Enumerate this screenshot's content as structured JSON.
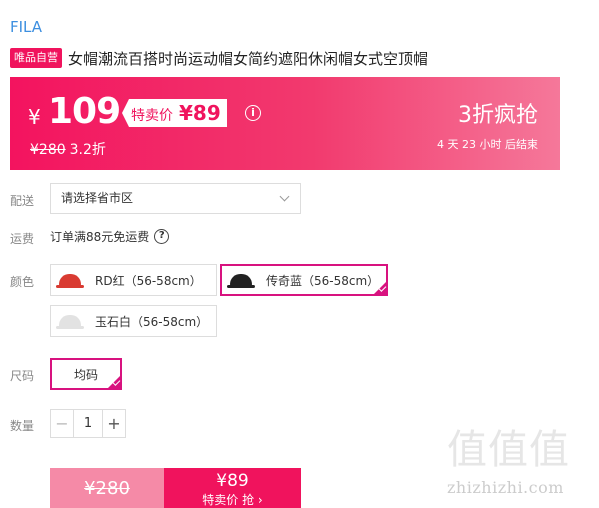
{
  "brand": "FILA",
  "product": {
    "tag": "唯品自营",
    "title": "女帽潮流百搭时尚运动帽女简约遮阳休闲帽女式空顶帽"
  },
  "price": {
    "currency": "¥",
    "main": "109",
    "special_label": "特卖价",
    "special_price": "¥89",
    "info_icon": "i",
    "original": "¥280",
    "discount": "3.2折",
    "promo": "3折疯抢",
    "countdown": "4 天 23 小时 后结束",
    "colors": {
      "accent": "#f0135d",
      "selected_border": "#d8127f"
    }
  },
  "delivery": {
    "label": "配送",
    "placeholder": "请选择省市区"
  },
  "shipping": {
    "label": "运费",
    "text": "订单满88元免运费",
    "help_icon": "?"
  },
  "color": {
    "label": "颜色",
    "options": [
      {
        "label": "RD红（56-58cm）",
        "icon": "red-cap-icon",
        "selected": false
      },
      {
        "label": "传奇蓝（56-58cm）",
        "icon": "black-cap-icon",
        "selected": true
      },
      {
        "label": "玉石白（56-58cm）",
        "icon": "white-cap-icon",
        "selected": false
      }
    ]
  },
  "size": {
    "label": "尺码",
    "options": [
      {
        "label": "均码",
        "selected": true
      }
    ]
  },
  "quantity": {
    "label": "数量",
    "minus": "−",
    "value": "1",
    "plus": "+"
  },
  "buy": {
    "original": "¥280",
    "price": "¥89",
    "action": "特卖价 抢 ›"
  },
  "watermark": {
    "logo": "值值值",
    "text": "zhizhizhi.com"
  }
}
